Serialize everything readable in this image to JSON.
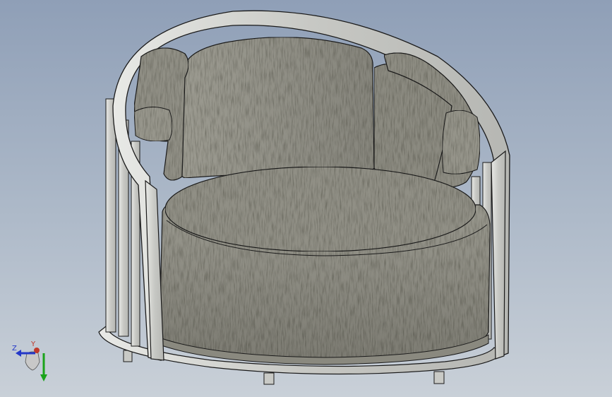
{
  "viewport": {
    "background_top": "#8f9fb7",
    "background_bottom": "#c9d0d8"
  },
  "model": {
    "fabric_color": "#8d8c82",
    "frame_color": "#cfd0cc",
    "edge_color": "#1a1a1a"
  },
  "triad": {
    "z_label": "Z",
    "y_label": "Y",
    "x_color": "#c0392b",
    "y_color": "#1aa31a",
    "z_color": "#2438c8"
  }
}
